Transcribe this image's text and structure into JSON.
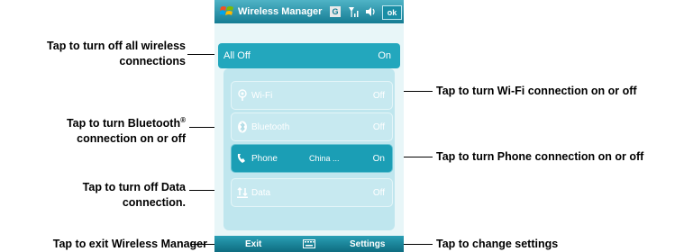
{
  "device": {
    "title": "Wireless Manager",
    "ok_label": "ok",
    "g_label": "G",
    "all_off": {
      "label": "All Off",
      "state": "On"
    },
    "rows": [
      {
        "label": "Wi-Fi",
        "detail": "",
        "state": "Off"
      },
      {
        "label": "Bluetooth",
        "detail": "",
        "state": "Off"
      },
      {
        "label": "Phone",
        "detail": "China ...",
        "state": "On"
      },
      {
        "label": "Data",
        "detail": "",
        "state": "Off"
      }
    ],
    "softkeys": {
      "left": "Exit",
      "right": "Settings"
    }
  },
  "callouts": {
    "all_off": "Tap to turn off all wireless connections",
    "bluetooth_pre": "Tap to turn Bluetooth",
    "bluetooth_reg": "®",
    "bluetooth_post": "connection on or off",
    "data": "Tap to turn off Data connection.",
    "exit": "Tap to exit Wireless Manager",
    "wifi": "Tap to turn Wi-Fi connection on or off",
    "phone": "Tap to turn Phone connection on or off",
    "settings": "Tap to change settings"
  },
  "colors": {
    "accent": "#23a7bd",
    "titlebar": "#157c93",
    "panel": "#bfe6ee"
  }
}
